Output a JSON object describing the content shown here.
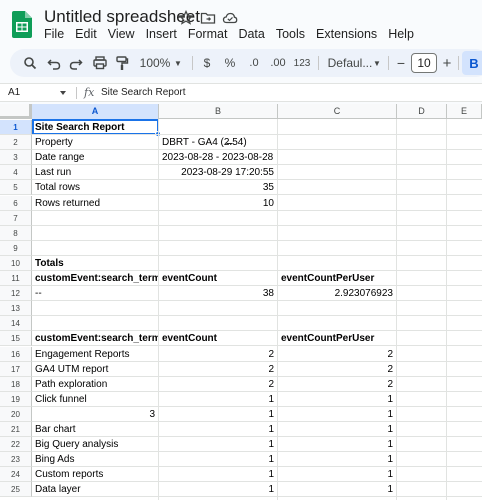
{
  "app": {
    "title": "Untitled spreadsheet",
    "menu": [
      "File",
      "Edit",
      "View",
      "Insert",
      "Format",
      "Data",
      "Tools",
      "Extensions",
      "Help"
    ]
  },
  "toolbar": {
    "zoom": "100%",
    "currency": "$",
    "percent": "%",
    "dec_decrease": ".0",
    "dec_increase": ".00",
    "number_format": "123",
    "font": "Defaul...",
    "font_size": "10",
    "minus": "−",
    "plus": "+",
    "bold": "B"
  },
  "formula_bar": {
    "name_box": "A1",
    "fx": "fx",
    "value": "Site Search Report"
  },
  "columns": [
    "A",
    "B",
    "C",
    "D",
    "E"
  ],
  "rows": [
    {
      "n": "1",
      "a": "Site Search Report",
      "b": "",
      "c": "",
      "bold": true
    },
    {
      "n": "2",
      "a": "Property",
      "b": "DBRT - GA4 (2̶̶̶̶̶.54)",
      "c": ""
    },
    {
      "n": "3",
      "a": "Date range",
      "b": "2023-08-28 - 2023-08-28",
      "c": ""
    },
    {
      "n": "4",
      "a": "Last run",
      "b": "2023-08-29 17:20:55",
      "c": "",
      "b_right": true
    },
    {
      "n": "5",
      "a": "Total rows",
      "b": "35",
      "c": "",
      "b_right": true
    },
    {
      "n": "6",
      "a": "Rows returned",
      "b": "10",
      "c": "",
      "b_right": true
    },
    {
      "n": "7",
      "a": "",
      "b": "",
      "c": ""
    },
    {
      "n": "8",
      "a": "",
      "b": "",
      "c": ""
    },
    {
      "n": "9",
      "a": "",
      "b": "",
      "c": ""
    },
    {
      "n": "10",
      "a": "Totals",
      "b": "",
      "c": "",
      "bold": true
    },
    {
      "n": "11",
      "a": "customEvent:search_term",
      "b": "eventCount",
      "c": "eventCountPerUser",
      "bold": true
    },
    {
      "n": "12",
      "a": "--",
      "b": "38",
      "c": "2.923076923",
      "b_right": true,
      "c_right": true
    },
    {
      "n": "13",
      "a": "",
      "b": "",
      "c": ""
    },
    {
      "n": "14",
      "a": "",
      "b": "",
      "c": ""
    },
    {
      "n": "15",
      "a": "customEvent:search_term",
      "b": "eventCount",
      "c": "eventCountPerUser",
      "bold": true
    },
    {
      "n": "16",
      "a": "Engagement Reports",
      "b": "2",
      "c": "2",
      "b_right": true,
      "c_right": true
    },
    {
      "n": "17",
      "a": "GA4 UTM report",
      "b": "2",
      "c": "2",
      "b_right": true,
      "c_right": true
    },
    {
      "n": "18",
      "a": "Path exploration",
      "b": "2",
      "c": "2",
      "b_right": true,
      "c_right": true
    },
    {
      "n": "19",
      "a": " Click funnel",
      "b": "1",
      "c": "1",
      "b_right": true,
      "c_right": true
    },
    {
      "n": "20",
      "a": "3",
      "b": "1",
      "c": "1",
      "a_right": true,
      "b_right": true,
      "c_right": true
    },
    {
      "n": "21",
      "a": "Bar chart",
      "b": "1",
      "c": "1",
      "b_right": true,
      "c_right": true
    },
    {
      "n": "22",
      "a": "Big Query analysis",
      "b": "1",
      "c": "1",
      "b_right": true,
      "c_right": true
    },
    {
      "n": "23",
      "a": "Bing Ads",
      "b": "1",
      "c": "1",
      "b_right": true,
      "c_right": true
    },
    {
      "n": "24",
      "a": "Custom reports",
      "b": "1",
      "c": "1",
      "b_right": true,
      "c_right": true
    },
    {
      "n": "25",
      "a": "Data layer",
      "b": "1",
      "c": "1",
      "b_right": true,
      "c_right": true
    }
  ]
}
